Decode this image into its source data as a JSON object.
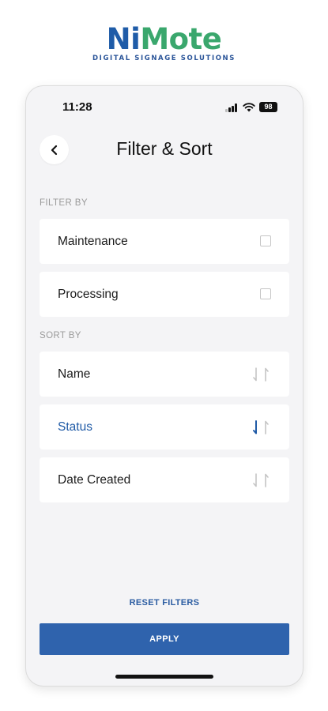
{
  "logo": {
    "name_part1": "Ni",
    "name_part2": "Mote",
    "tagline": "DIGITAL SIGNAGE SOLUTIONS",
    "colors": {
      "primary": "#1f5ca8",
      "secondary": "#3aa76d"
    }
  },
  "status_bar": {
    "time": "11:28",
    "battery": "98",
    "icons": [
      "signal-icon",
      "wifi-icon",
      "battery-icon"
    ]
  },
  "header": {
    "title": "Filter & Sort",
    "back_icon": "chevron-left-icon"
  },
  "filter": {
    "label": "FILTER BY",
    "items": [
      {
        "label": "Maintenance",
        "checked": false
      },
      {
        "label": "Processing",
        "checked": false
      }
    ]
  },
  "sort": {
    "label": "SORT BY",
    "items": [
      {
        "label": "Name",
        "active": false,
        "direction": "none"
      },
      {
        "label": "Status",
        "active": true,
        "direction": "down"
      },
      {
        "label": "Date Created",
        "active": false,
        "direction": "none"
      }
    ]
  },
  "actions": {
    "reset_label": "RESET FILTERS",
    "apply_label": "APPLY"
  },
  "colors": {
    "accent": "#2f63ad",
    "active_text": "#1f5aa6",
    "inactive_arrow": "#c4c4c4"
  }
}
